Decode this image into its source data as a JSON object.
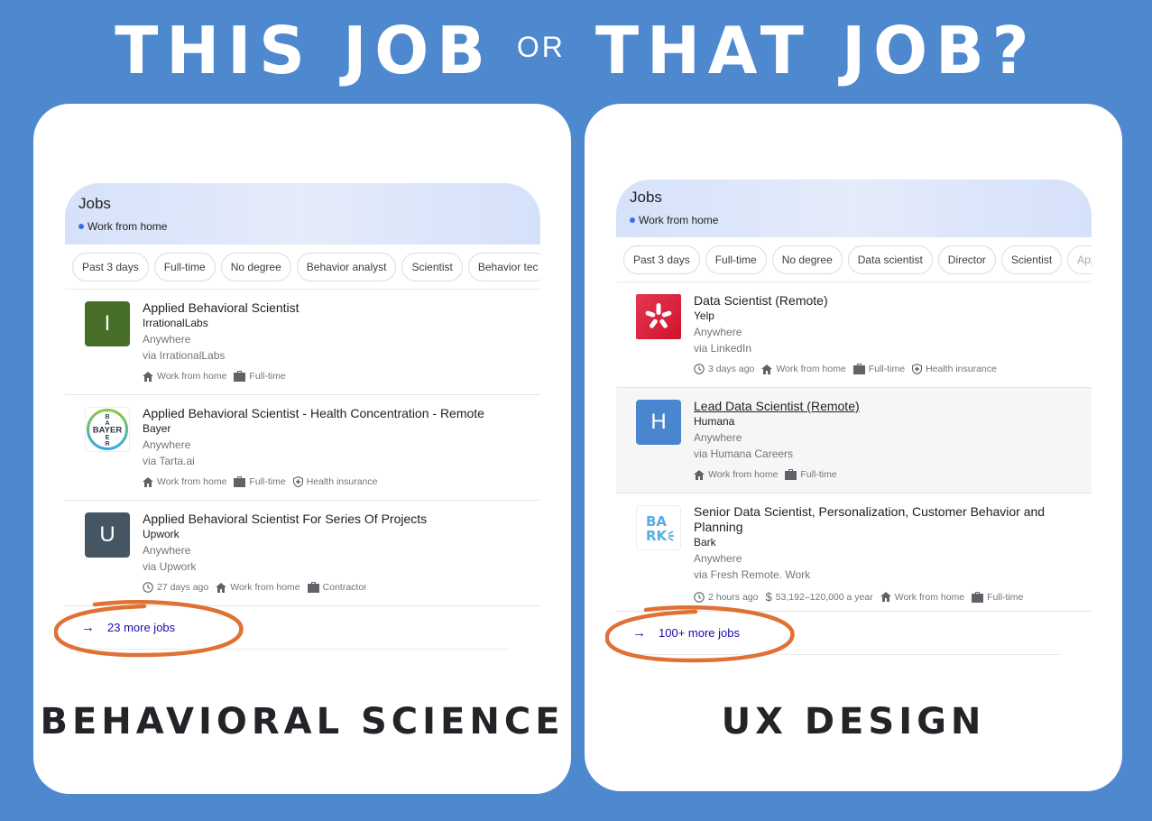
{
  "headline": {
    "left": "THIS JOB",
    "connector": "OR",
    "right": "THAT JOB?"
  },
  "colors": {
    "background": "#4e88cf",
    "panel": "#ffffff",
    "highlight_circle": "#e07033",
    "link": "#1a0dab",
    "label": "#222428"
  },
  "panels": [
    {
      "label": "BEHAVIORAL SCIENCE",
      "widget": {
        "title": "Jobs",
        "filter": "Work from home",
        "chips": [
          "Past 3 days",
          "Full-time",
          "No degree",
          "Behavior analyst",
          "Scientist",
          "Behavior tec"
        ],
        "jobs": [
          {
            "logo_letter": "I",
            "logo_icon": "irrationallabs-logo",
            "title": "Applied Behavioral Scientist",
            "company": "IrrationalLabs",
            "location": "Anywhere",
            "via": "via IrrationalLabs",
            "meta": [
              {
                "icon": "home-icon",
                "text": "Work from home"
              },
              {
                "icon": "briefcase-icon",
                "text": "Full-time"
              }
            ]
          },
          {
            "logo_letter": "BAYER",
            "logo_icon": "bayer-logo",
            "title": "Applied Behavioral Scientist - Health Concentration - Remote",
            "company": "Bayer",
            "location": "Anywhere",
            "via": "via Tarta.ai",
            "meta": [
              {
                "icon": "home-icon",
                "text": "Work from home"
              },
              {
                "icon": "briefcase-icon",
                "text": "Full-time"
              },
              {
                "icon": "shield-plus-icon",
                "text": "Health insurance"
              }
            ]
          },
          {
            "logo_letter": "U",
            "logo_icon": "upwork-logo",
            "title": "Applied Behavioral Scientist For Series Of Projects",
            "company": "Upwork",
            "location": "Anywhere",
            "via": "via Upwork",
            "meta": [
              {
                "icon": "clock-icon",
                "text": "27 days ago"
              },
              {
                "icon": "home-icon",
                "text": "Work from home"
              },
              {
                "icon": "briefcase-icon",
                "text": "Contractor"
              }
            ]
          }
        ],
        "more_jobs": "23 more jobs"
      }
    },
    {
      "label": "UX DESIGN",
      "widget": {
        "title": "Jobs",
        "filter": "Work from home",
        "chips": [
          "Past 3 days",
          "Full-time",
          "No degree",
          "Data scientist",
          "Director",
          "Scientist",
          "App"
        ],
        "jobs": [
          {
            "logo_letter": "",
            "logo_icon": "yelp-logo",
            "title": "Data Scientist (Remote)",
            "company": "Yelp",
            "location": "Anywhere",
            "via": "via LinkedIn",
            "meta": [
              {
                "icon": "clock-icon",
                "text": "3 days ago"
              },
              {
                "icon": "home-icon",
                "text": "Work from home"
              },
              {
                "icon": "briefcase-icon",
                "text": "Full-time"
              },
              {
                "icon": "shield-plus-icon",
                "text": "Health insurance"
              }
            ]
          },
          {
            "logo_letter": "H",
            "logo_icon": "humana-logo",
            "title": "Lead Data Scientist (Remote)",
            "company": "Humana",
            "location": "Anywhere",
            "via": "via Humana Careers",
            "meta": [
              {
                "icon": "home-icon",
                "text": "Work from home"
              },
              {
                "icon": "briefcase-icon",
                "text": "Full-time"
              }
            ]
          },
          {
            "logo_letter": "BARK",
            "logo_icon": "bark-logo",
            "title": "Senior Data Scientist, Personalization, Customer Behavior and Planning",
            "company": "Bark",
            "location": "Anywhere",
            "via": "via Fresh Remote. Work",
            "meta": [
              {
                "icon": "clock-icon",
                "text": "2 hours ago"
              },
              {
                "icon": "dollar-icon",
                "text": "53,192–120,000 a year"
              },
              {
                "icon": "home-icon",
                "text": "Work from home"
              },
              {
                "icon": "briefcase-icon",
                "text": "Full-time"
              }
            ]
          }
        ],
        "more_jobs": "100+ more jobs"
      }
    }
  ]
}
